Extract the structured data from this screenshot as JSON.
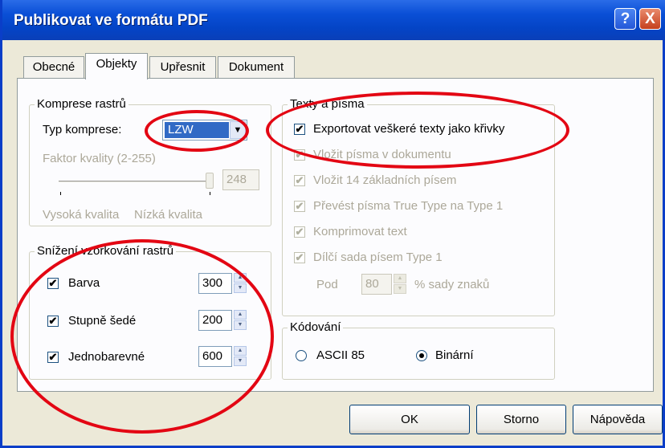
{
  "window": {
    "title": "Publikovat ve formátu PDF",
    "help_label": "?",
    "close_label": "X"
  },
  "tabs": [
    {
      "label": "Obecné"
    },
    {
      "label": "Objekty"
    },
    {
      "label": "Upřesnit"
    },
    {
      "label": "Dokument"
    }
  ],
  "compression": {
    "legend": "Komprese rastrů",
    "type_label": "Typ komprese:",
    "type_value": "LZW",
    "quality_label": "Faktor kvality (2-255)",
    "quality_value": "248",
    "high_label": "Vysoká kvalita",
    "low_label": "Nízká kvalita"
  },
  "downsampling": {
    "legend": "Snížení vzorkování rastrů",
    "items": [
      {
        "label": "Barva",
        "value": "300",
        "checked": true
      },
      {
        "label": "Stupně šedé",
        "value": "200",
        "checked": true
      },
      {
        "label": "Jednobarevné",
        "value": "600",
        "checked": true
      }
    ]
  },
  "texts": {
    "legend": "Texty a písma",
    "items": [
      {
        "label": "Exportovat veškeré texty jako křivky",
        "checked": true,
        "enabled": true
      },
      {
        "label": "Vložit písma v dokumentu",
        "checked": true,
        "enabled": false
      },
      {
        "label": "Vložit 14 základních písem",
        "checked": true,
        "enabled": false
      },
      {
        "label": "Převést písma True Type na Type 1",
        "checked": true,
        "enabled": false
      },
      {
        "label": "Komprimovat text",
        "checked": true,
        "enabled": false
      },
      {
        "label": "Dílčí sada písem Type 1",
        "checked": true,
        "enabled": false
      }
    ],
    "subset_label_pre": "Pod",
    "subset_value": "80",
    "subset_label_post": "% sady znaků"
  },
  "encoding": {
    "legend": "Kódování",
    "options": [
      {
        "label": "ASCII 85",
        "selected": false
      },
      {
        "label": "Binární",
        "selected": true
      }
    ]
  },
  "buttons": {
    "ok": "OK",
    "cancel": "Storno",
    "help": "Nápověda"
  },
  "icons": {
    "check": "✔",
    "dropdown": "▼",
    "spin_up": "▲",
    "spin_down": "▼"
  },
  "colors": {
    "title_bar": "#0a4fd6",
    "annotation": "#e30613",
    "dropdown_selected": "#316ac5"
  }
}
